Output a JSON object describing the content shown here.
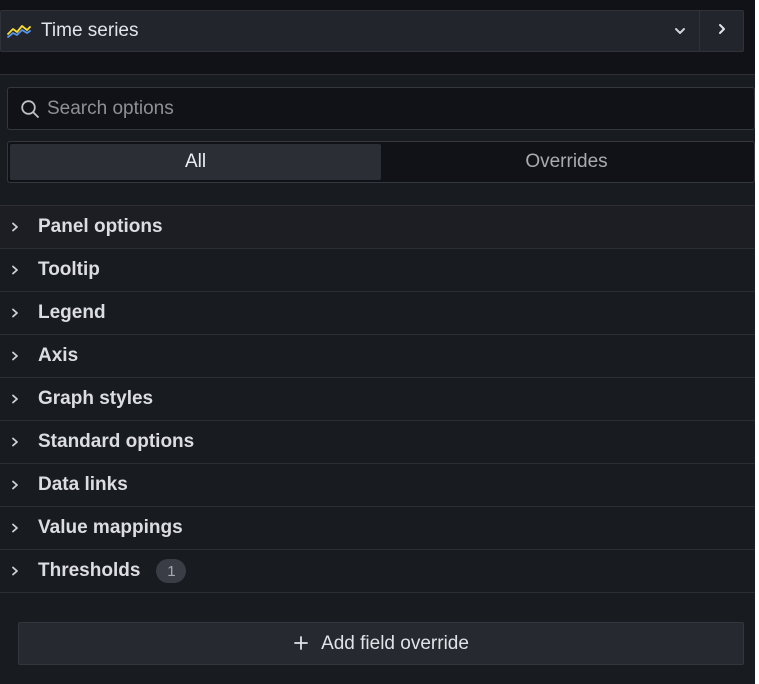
{
  "visualization": {
    "name": "Time series",
    "icon": "time-series-chart-icon"
  },
  "search": {
    "placeholder": "Search options",
    "value": ""
  },
  "tabs": [
    {
      "label": "All",
      "active": true
    },
    {
      "label": "Overrides",
      "active": false
    }
  ],
  "sections": [
    {
      "label": "Panel options"
    },
    {
      "label": "Tooltip"
    },
    {
      "label": "Legend"
    },
    {
      "label": "Axis"
    },
    {
      "label": "Graph styles"
    },
    {
      "label": "Standard options"
    },
    {
      "label": "Data links"
    },
    {
      "label": "Value mappings"
    },
    {
      "label": "Thresholds",
      "badge": "1"
    }
  ],
  "add_override": {
    "label": "Add field override",
    "icon": "plus-icon"
  },
  "colors": {
    "background": "#181b1f",
    "header": "#111217",
    "accent_blue": "#5794f2",
    "accent_yellow": "#fade2a"
  }
}
